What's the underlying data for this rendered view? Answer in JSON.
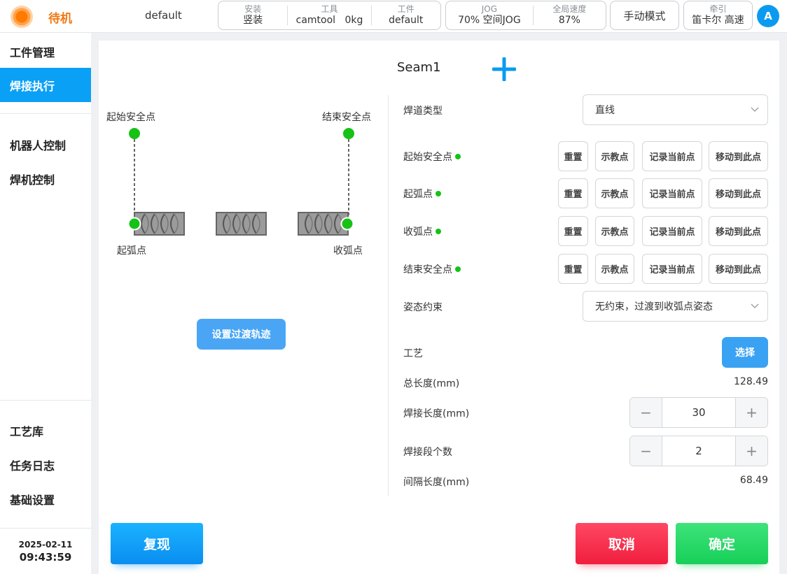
{
  "header": {
    "status": "待机",
    "project": "default",
    "install": {
      "label": "安装",
      "value": "竖装"
    },
    "tool": {
      "label": "工具",
      "name": "camtool",
      "load": "0kg"
    },
    "workpiece": {
      "label": "工件",
      "value": "default"
    },
    "jog": {
      "label": "JOG",
      "value": "70%   空间JOG"
    },
    "global_speed": {
      "label": "全局速度",
      "value": "87%"
    },
    "mode_button": "手动模式",
    "traction": {
      "label": "牵引",
      "value": "笛卡尔    高速"
    },
    "avatar": "A",
    "brand_color": "#f07a14",
    "accent_color": "#0aa0f5"
  },
  "sidebar": {
    "items": [
      {
        "label": "工件管理"
      },
      {
        "label": "焊接执行"
      },
      {
        "label": "机器人控制"
      },
      {
        "label": "焊机控制"
      },
      {
        "label": "工艺库"
      },
      {
        "label": "任务日志"
      },
      {
        "label": "基础设置"
      }
    ],
    "active": "焊接执行",
    "date": "2025-02-11",
    "time": "09:43:59"
  },
  "main": {
    "seam_title": "Seam1",
    "diagram": {
      "start_safe": "起始安全点",
      "end_safe": "结束安全点",
      "arc_start": "起弧点",
      "arc_end": "收弧点"
    },
    "transition_button": "设置过渡轨迹",
    "form": {
      "seam_type_label": "焊道类型",
      "seam_type_value": "直线",
      "points": [
        {
          "label": "起始安全点"
        },
        {
          "label": "起弧点"
        },
        {
          "label": "收弧点"
        },
        {
          "label": "结束安全点"
        }
      ],
      "buttons": {
        "reset": "重置",
        "teach": "示教点",
        "record": "记录当前点",
        "move": "移动到此点"
      },
      "pose_label": "姿态约束",
      "pose_value": "无约束，过渡到收弧点姿态",
      "process_label": "工艺",
      "select_button": "选择",
      "total_length_label": "总长度(mm)",
      "total_length_value": "128.49",
      "weld_length_label": "焊接长度(mm)",
      "weld_length_value": "30",
      "segments_label": "焊接段个数",
      "segments_value": "2",
      "gap_length_label": "间隔长度(mm)",
      "gap_length_value": "68.49",
      "minus": "−",
      "plus": "+"
    },
    "footer": {
      "replay": "复现",
      "cancel": "取消",
      "confirm": "确定"
    }
  }
}
